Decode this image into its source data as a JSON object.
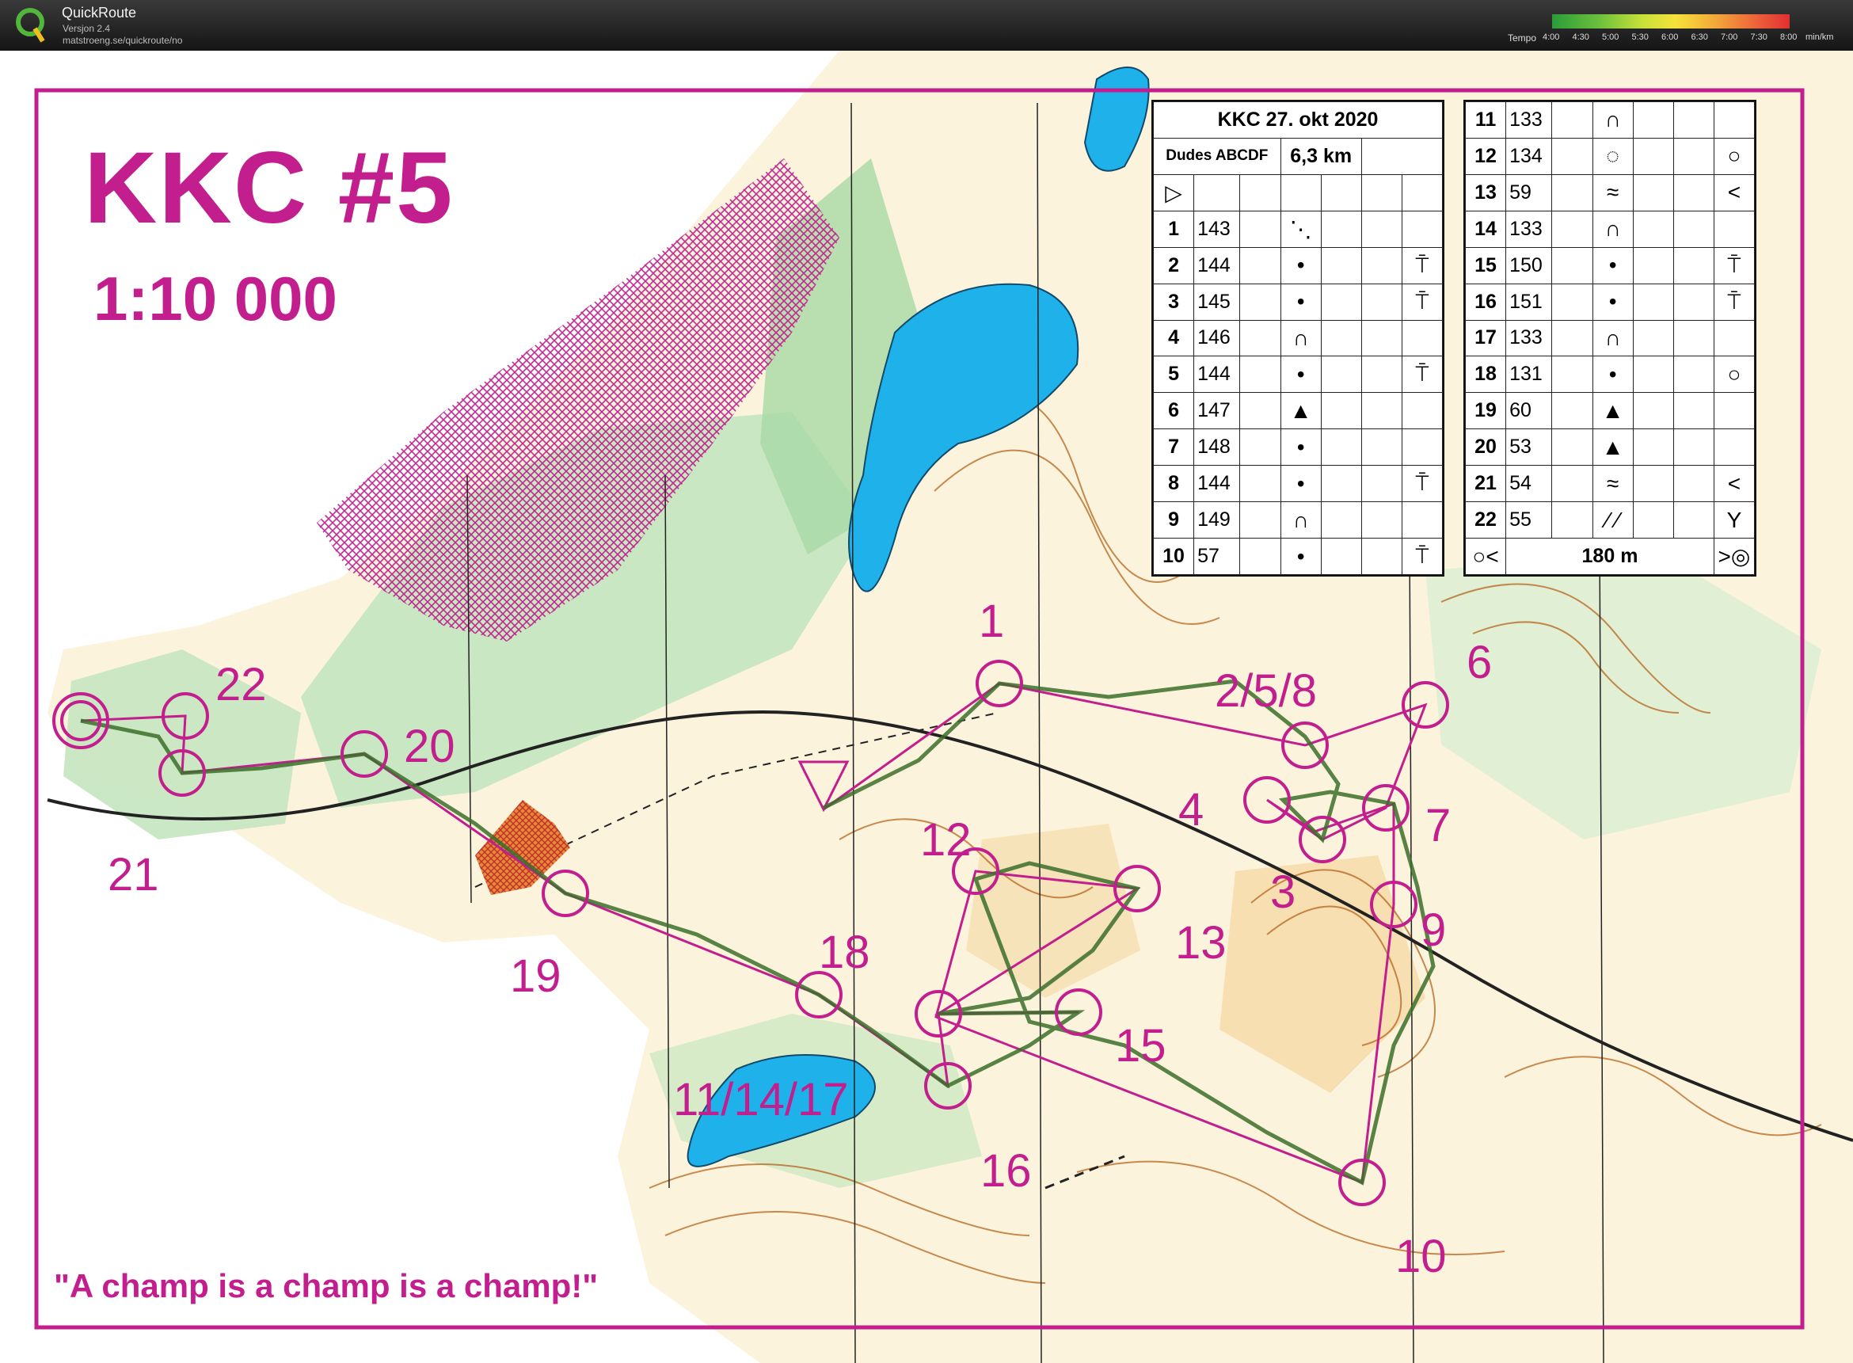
{
  "app": {
    "name": "QuickRoute",
    "version": "Versjon 2.4",
    "url": "matstroeng.se/quickroute/no",
    "tempo_label": "Tempo",
    "tempo_ticks": [
      "4:00",
      "4:30",
      "5:00",
      "5:30",
      "6:00",
      "6:30",
      "7:00",
      "7:30",
      "8:00"
    ],
    "tempo_unit": "min/km"
  },
  "map": {
    "title": "KKC #5",
    "scale": "1:10 000",
    "quote": "\"A champ is a champ is a champ!\"",
    "course_color": "#c21e8e",
    "route_color": "#3b6e2a",
    "water_color": "#1fb2ea",
    "control_labels": {
      "c1": "1",
      "c2": "2/5/8",
      "c3": "3",
      "c4": "4",
      "c6": "6",
      "c7": "7",
      "c9": "9",
      "c10": "10",
      "c11": "11/14/17",
      "c12": "12",
      "c13": "13",
      "c15": "15",
      "c16": "16",
      "c18": "18",
      "c19": "19",
      "c20": "20",
      "c21": "21",
      "c22": "22"
    }
  },
  "description": {
    "event": "KKC 27. okt 2020",
    "class": "Dudes ABCDF",
    "length": "6,3 km",
    "finish_distance": "180 m",
    "left_rows": [
      {
        "n": "1",
        "code": "143",
        "feature": "⋱",
        "where": ""
      },
      {
        "n": "2",
        "code": "144",
        "feature": "•",
        "where": "⍑"
      },
      {
        "n": "3",
        "code": "145",
        "feature": "•",
        "where": "⍑"
      },
      {
        "n": "4",
        "code": "146",
        "feature": "∩",
        "where": ""
      },
      {
        "n": "5",
        "code": "144",
        "feature": "•",
        "where": "⍑"
      },
      {
        "n": "6",
        "code": "147",
        "feature": "▲",
        "where": ""
      },
      {
        "n": "7",
        "code": "148",
        "feature": "•",
        "where": ""
      },
      {
        "n": "8",
        "code": "144",
        "feature": "•",
        "where": "⍑"
      },
      {
        "n": "9",
        "code": "149",
        "feature": "∩",
        "where": ""
      },
      {
        "n": "10",
        "code": "57",
        "feature": "•",
        "where": "⍑"
      }
    ],
    "right_rows": [
      {
        "n": "11",
        "code": "133",
        "feature": "∩",
        "where": ""
      },
      {
        "n": "12",
        "code": "134",
        "feature": "◌",
        "where": "○"
      },
      {
        "n": "13",
        "code": "59",
        "feature": "≈",
        "where": "<"
      },
      {
        "n": "14",
        "code": "133",
        "feature": "∩",
        "where": ""
      },
      {
        "n": "15",
        "code": "150",
        "feature": "•",
        "where": "⍑"
      },
      {
        "n": "16",
        "code": "151",
        "feature": "•",
        "where": "⍑"
      },
      {
        "n": "17",
        "code": "133",
        "feature": "∩",
        "where": ""
      },
      {
        "n": "18",
        "code": "131",
        "feature": "•",
        "where": "○"
      },
      {
        "n": "19",
        "code": "60",
        "feature": "▲",
        "where": ""
      },
      {
        "n": "20",
        "code": "53",
        "feature": "▲",
        "where": ""
      },
      {
        "n": "21",
        "code": "54",
        "feature": "≈",
        "where": "<"
      },
      {
        "n": "22",
        "code": "55",
        "feature": "⁄ ⁄",
        "where": "Y"
      }
    ]
  }
}
